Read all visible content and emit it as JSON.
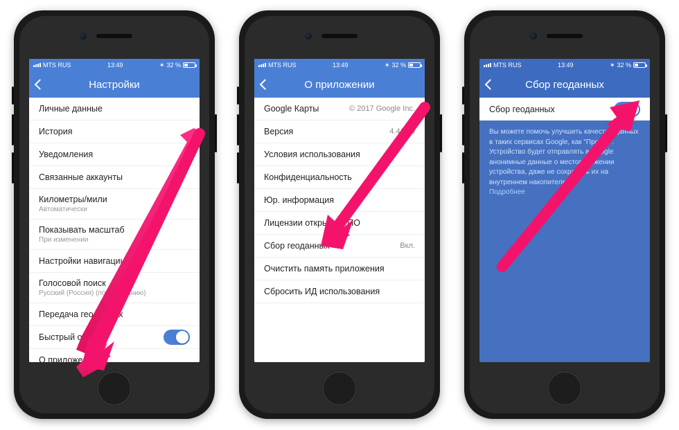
{
  "status": {
    "carrier": "MTS RUS",
    "time": "13:49",
    "batt_pct": "32 %",
    "bt_icon": "bluetooth",
    "battery_fill": 32
  },
  "phone1": {
    "title": "Настройки",
    "rows": [
      {
        "label": "Личные данные"
      },
      {
        "label": "История"
      },
      {
        "label": "Уведомления"
      },
      {
        "label": "Связанные аккаунты"
      },
      {
        "label": "Километры/мили",
        "sub": "Автоматически"
      },
      {
        "label": "Показывать масштаб",
        "sub": "При изменении"
      },
      {
        "label": "Настройки навигации"
      },
      {
        "label": "Голосовой поиск",
        "sub": "Русский (Россия) (по умолчанию)"
      },
      {
        "label": "Передача геоданных"
      },
      {
        "label": "Быстрый отзыв",
        "toggle": true
      },
      {
        "label": "О приложении"
      }
    ]
  },
  "phone2": {
    "title": "О приложении",
    "rows": [
      {
        "label": "Google Карты",
        "right": "© 2017 Google Inc."
      },
      {
        "label": "Версия",
        "right": "4.41.10"
      },
      {
        "label": "Условия использования"
      },
      {
        "label": "Конфиденциальность"
      },
      {
        "label": "Юр. информация"
      },
      {
        "label": "Лицензии открытого ПО"
      },
      {
        "label": "Сбор геоданных",
        "right": "Вкл."
      },
      {
        "label": "Очистить память приложения"
      },
      {
        "label": "Сбросить ИД использования"
      }
    ]
  },
  "phone3": {
    "title": "Сбор геоданных",
    "toggle_row_label": "Сбор геоданных",
    "desc": "Вы можете помочь улучшить качество данных в таких сервисах Google, как \"Пробки\". Устройство будет отправлять в Google анонимные данные о местоположении устройства, даже не сохранять их на внутреннем накопителе.",
    "more": "Подробнее"
  }
}
